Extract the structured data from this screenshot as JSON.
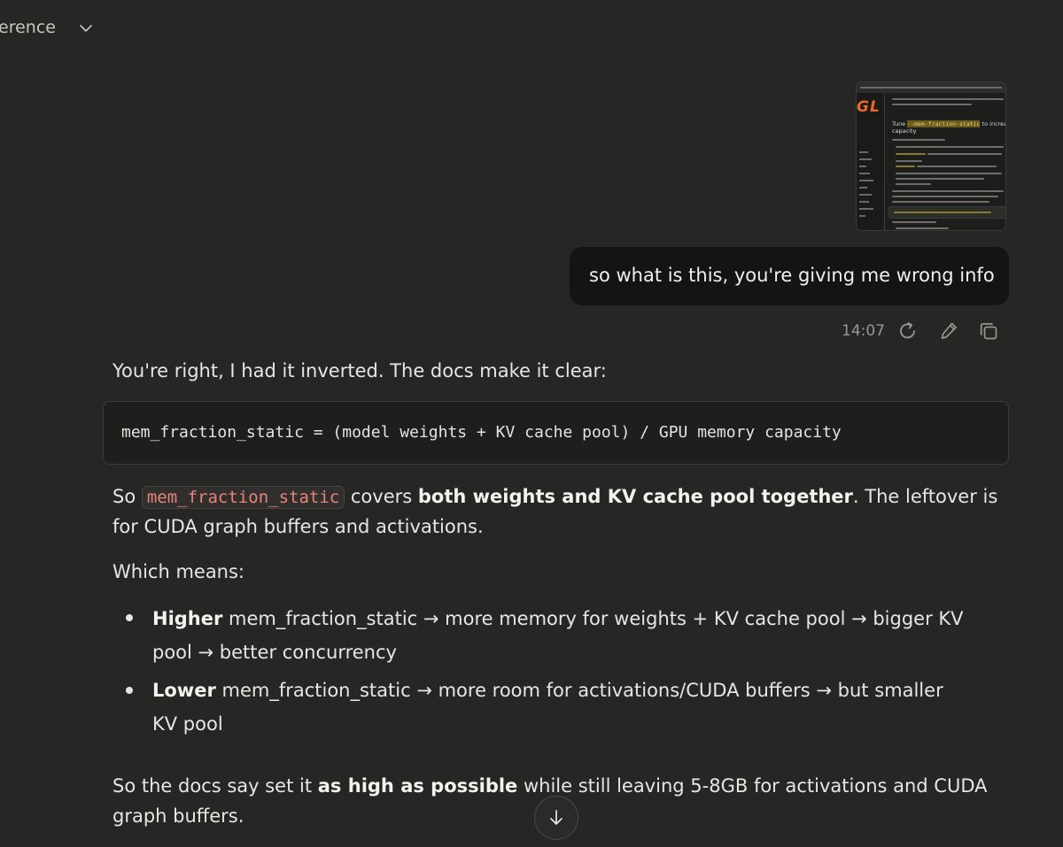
{
  "header": {
    "title": "erence"
  },
  "attachment": {
    "logo_text": "GL",
    "heading_pre": "Tune ",
    "heading_code": "--mem-fraction-static",
    "heading_post": " to increase KV cache",
    "heading_line2": "capacity"
  },
  "user_message": {
    "text": "so what is this, you're giving me wrong info",
    "time": "14:07"
  },
  "response": {
    "intro": "You're right, I had it inverted. The docs make it clear:",
    "code": "mem_fraction_static = (model weights + KV cache pool) / GPU memory capacity",
    "p1_pre": "So ",
    "p1_code": "mem_fraction_static",
    "p1_mid": " covers ",
    "p1_bold": "both weights and KV cache pool together",
    "p1_post": ". The leftover is",
    "p1_line2": "for CUDA graph buffers and activations.",
    "which_means": "Which means:",
    "bullets": [
      {
        "bold": "Higher",
        "line1": " mem_fraction_static → more memory for weights + KV cache pool → bigger KV",
        "line2": "pool → better concurrency"
      },
      {
        "bold": "Lower",
        "line1": " mem_fraction_static → more room for activations/CUDA buffers → but smaller",
        "line2": "KV pool"
      }
    ],
    "closing_pre": "So the docs say set it ",
    "closing_bold": "as high as possible",
    "closing_post": " while still leaving 5-8GB for activations and CUDA",
    "closing_line2": "graph buffers."
  },
  "icons": {
    "title_dropdown": "chevron-down-icon",
    "retry": "retry-icon",
    "edit": "pencil-icon",
    "copy": "copy-icon",
    "scroll": "arrow-down-icon"
  },
  "colors": {
    "background": "#262624",
    "user_bubble": "#141413",
    "inline_code": "#e8847a",
    "attachment_logo": "#e86a2a"
  }
}
